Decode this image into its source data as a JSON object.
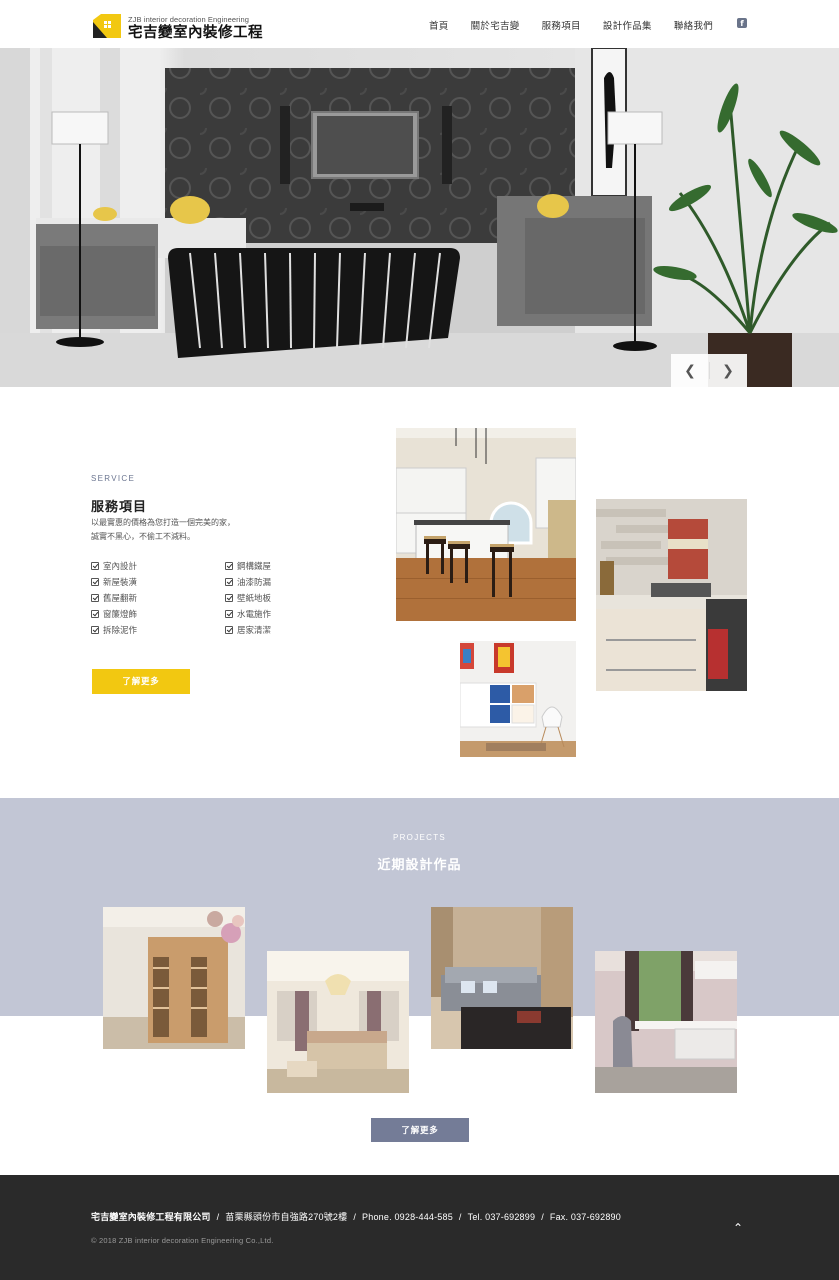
{
  "header": {
    "brand_en": "ZJB interior decoration Engineering",
    "brand_zh": "宅吉變室內裝修工程",
    "nav": [
      {
        "label": "首頁"
      },
      {
        "label": "關於宅吉變"
      },
      {
        "label": "服務項目"
      },
      {
        "label": "設計作品集"
      },
      {
        "label": "聯絡我們"
      }
    ],
    "facebook_icon": "facebook-icon"
  },
  "hero": {
    "prev_icon": "chevron-left-icon",
    "next_icon": "chevron-right-icon"
  },
  "service": {
    "eyebrow": "SERVICE",
    "title": "服務項目",
    "desc_line1": "以最實惠的價格為您打造一個完美的家，",
    "desc_line2": "誠實不黑心，不偷工不減料。",
    "col1": [
      "室內設計",
      "新屋裝潢",
      "舊屋翻新",
      "窗簾燈飾",
      "拆除泥作"
    ],
    "col2": [
      "鋼構鐵屋",
      "油漆防漏",
      "壁紙地板",
      "水電施作",
      "居家清潔"
    ],
    "button": "了解更多"
  },
  "projects": {
    "eyebrow": "PROJECTS",
    "title": "近期設計作品",
    "button": "了解更多"
  },
  "footer": {
    "company": "宅吉變室內裝修工程有限公司",
    "address": "苗栗縣頭份市自強路270號2樓",
    "phone": "Phone. 0928-444-585",
    "tel": "Tel. 037-692899",
    "fax": "Fax. 037-692890",
    "separator": "/",
    "copyright": "© 2018 ZJB interior decoration Engineering Co.,Ltd.",
    "top_icon": "chevron-up-icon"
  },
  "colors": {
    "accent_yellow": "#f2c811",
    "band_gray": "#c2c6d5",
    "button_slate": "#747c97",
    "footer_dark": "#2a2a2a"
  }
}
